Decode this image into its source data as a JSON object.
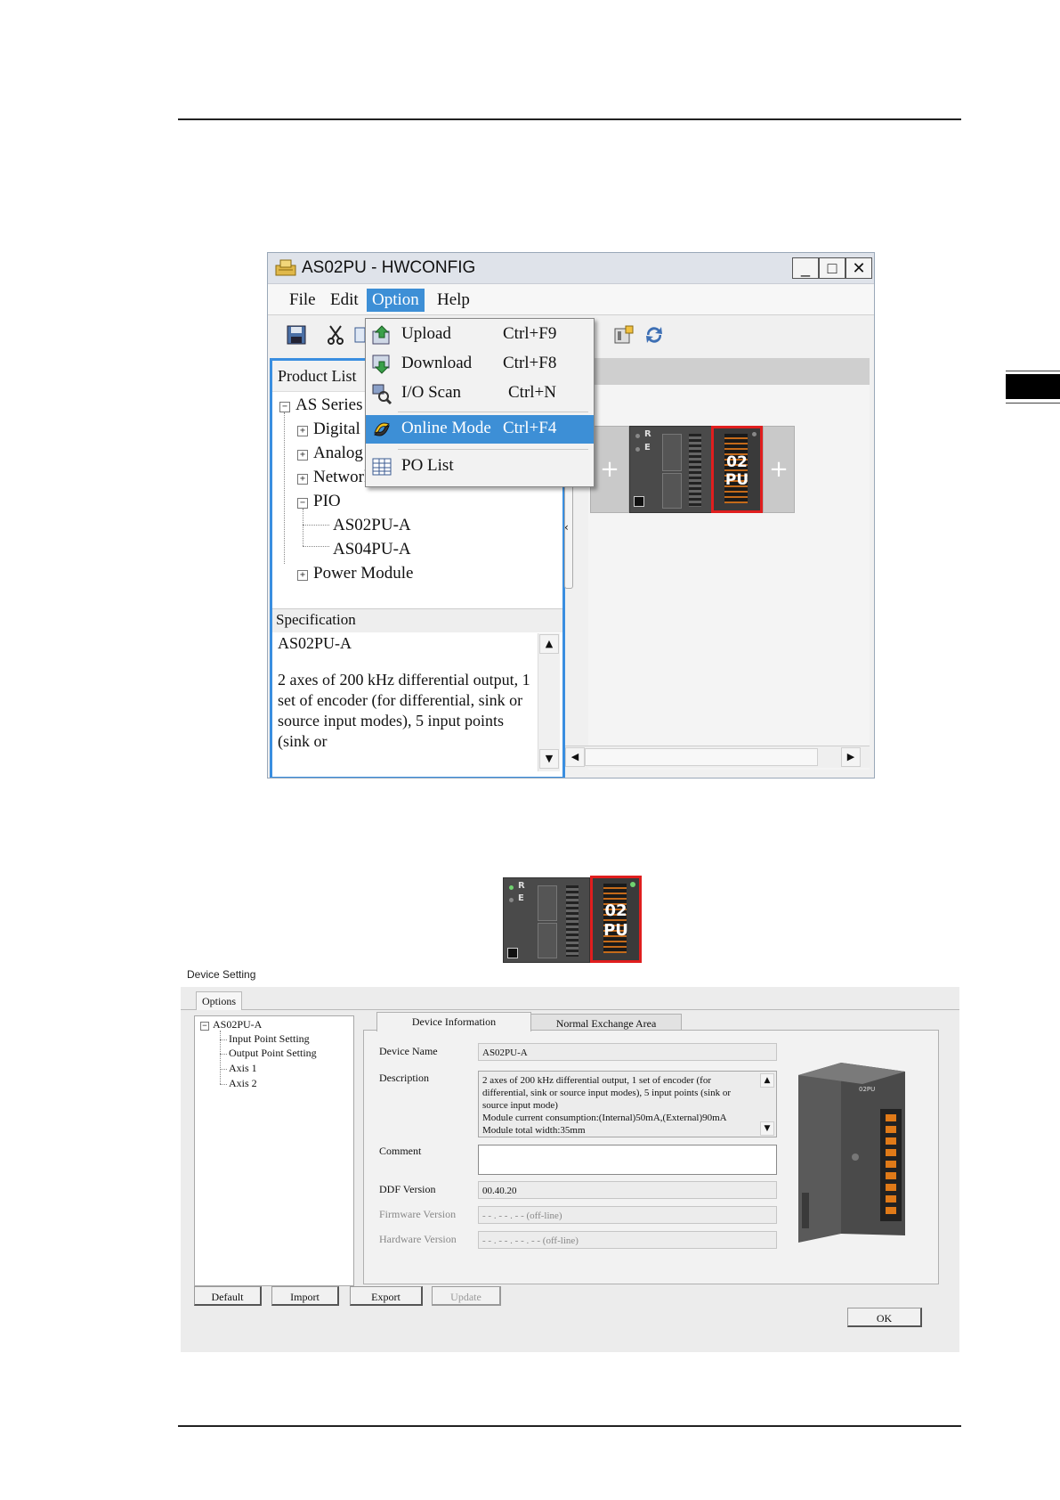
{
  "hwconfig": {
    "title": "AS02PU - HWCONFIG",
    "window_buttons": {
      "minimize": "_",
      "maximize": "□",
      "close": "✕"
    },
    "menu": [
      "File",
      "Edit",
      "Option",
      "Help"
    ],
    "option_menu": {
      "items": [
        {
          "label": "Upload",
          "shortcut": "Ctrl+F9",
          "icon": "upload-icon"
        },
        {
          "label": "Download",
          "shortcut": "Ctrl+F8",
          "icon": "download-icon"
        },
        {
          "label": "I/O Scan",
          "shortcut": "Ctrl+N",
          "icon": "io-scan-icon"
        },
        {
          "label": "Online Mode",
          "shortcut": "Ctrl+F4",
          "icon": "online-mode-icon",
          "highlighted": true
        },
        {
          "label": "PO List",
          "shortcut": "",
          "icon": "po-list-icon"
        }
      ]
    },
    "product_list": {
      "header": "Product List",
      "tree": {
        "root": "AS Series",
        "groups": [
          "Digital",
          "Analog",
          "Network Module",
          "PIO",
          "Power Module"
        ],
        "pio_children": [
          "AS02PU-A",
          "AS04PU-A"
        ]
      }
    },
    "specification": {
      "header": "Specification",
      "model": "AS02PU-A",
      "text": "2 axes of 200 kHz differential output, 1 set of encoder (for differential, sink or source input modes), 5 input points (sink or"
    },
    "rack": {
      "cpu_led_labels": [
        "R",
        "E"
      ],
      "module_label_top": "02",
      "module_label_bottom": "PU",
      "add_symbol": "+"
    }
  },
  "device_setting": {
    "title": "Device Setting",
    "options_tab": "Options",
    "tree": {
      "root": "AS02PU-A",
      "children": [
        "Input Point Setting",
        "Output Point Setting",
        "Axis 1",
        "Axis 2"
      ]
    },
    "tabs": [
      "Device Information",
      "Normal Exchange Area"
    ],
    "fields": {
      "device_name_label": "Device Name",
      "device_name": "AS02PU-A",
      "description_label": "Description",
      "description_lines": [
        "2 axes of 200 kHz differential output, 1 set of encoder (for",
        "differential, sink or source input modes), 5 input points (sink or",
        "source input mode)",
        "Module current consumption:(Internal)50mA,(External)90mA",
        "Module total width:35mm"
      ],
      "comment_label": "Comment",
      "comment": "",
      "ddf_version_label": "DDF Version",
      "ddf_version": "00.40.20",
      "firmware_version_label": "Firmware Version",
      "firmware_version": "- - . - - . - -  (off-line)",
      "hardware_version_label": "Hardware Version",
      "hardware_version": "- - . - - . - - . - -  (off-line)"
    },
    "product_image_label": "02PU",
    "buttons": {
      "default": "Default",
      "import": "Import",
      "export": "Export",
      "update": "Update",
      "ok": "OK"
    }
  },
  "colors": {
    "accent": "#3d8fd6",
    "module_highlight": "#e01e1e",
    "panel_border": "#3a8ee0"
  }
}
